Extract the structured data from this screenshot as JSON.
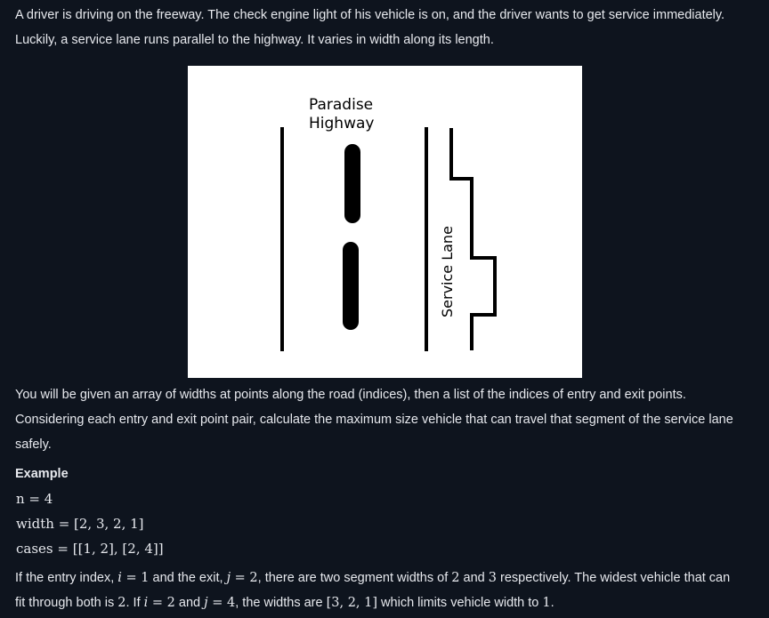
{
  "intro": {
    "line1": "A driver is driving on the freeway. The check engine light of his vehicle is on, and the driver wants to get service immediately.",
    "line2": "Luckily, a service lane runs parallel to the highway. It varies in width along its length."
  },
  "figure": {
    "highway_label_line1": "Paradise",
    "highway_label_line2": "Highway",
    "service_lane_label": "Service Lane",
    "background_color": "#ffffff",
    "ink_color": "#000000"
  },
  "body": {
    "line1": "You will be given an array of widths at points along the road (indices), then a list of the indices of entry and exit points.",
    "line2": "Considering each entry and exit point pair, calculate the maximum size vehicle that can travel that segment of the service lane",
    "line3": "safely."
  },
  "example": {
    "heading": "Example",
    "n_expr": "n = 4",
    "width_expr": "width = [2, 3, 2, 1]",
    "cases_expr": "cases = [[1, 2], [2, 4]]"
  },
  "explanation": {
    "l1_a": "If the entry index, ",
    "l1_i": "i",
    "l1_eq1": " = 1",
    "l1_b": " and the exit, ",
    "l1_j": "j",
    "l1_eq2": " = 2",
    "l1_c": ", there are two segment widths of ",
    "l1_v1": "2",
    "l1_d": " and ",
    "l1_v2": "3",
    "l1_e": " respectively. The widest vehicle that can",
    "l2_a": "fit through both is ",
    "l2_v1": "2",
    "l2_b": ". If ",
    "l2_i": "i",
    "l2_eq1": " = 2",
    "l2_c": " and ",
    "l2_j": "j",
    "l2_eq2": " = 4",
    "l2_d": ", the widths are ",
    "l2_arr": "[3, 2, 1]",
    "l2_e": " which limits vehicle width to ",
    "l2_v2": "1",
    "l2_f": "."
  },
  "colors": {
    "page_background": "#0e141e",
    "text": "#e7e9ee"
  }
}
